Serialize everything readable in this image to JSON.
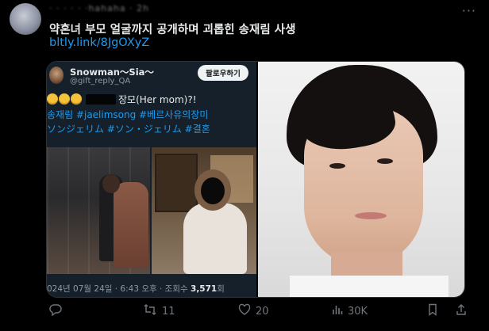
{
  "header": {
    "meta": "· · · · · ·hahaha · 2h"
  },
  "tweet": {
    "text": "약혼녀 부모 얼굴까지 공개하며 괴롭힌 송재림 사생",
    "link": "bltly.link/8JgOXyZ"
  },
  "embedded": {
    "name": "Snowman〜Sia〜",
    "handle": "@gift_reply_QA",
    "translate_button": "팔로우하기",
    "text_line1": "장모(Her mom)?!",
    "hashtags_line1": "송재림 #jaelimsong #베르사유의장미",
    "hashtags_line2": "ソンジェリム #ソン・ジェリム #결혼",
    "timestamp": "024년 07월 24일 · 6:43 오후 · 조회수",
    "views": "3,571",
    "views_suffix": "회"
  },
  "actions": {
    "reply_count": "",
    "retweet_count": "11",
    "like_count": "20",
    "view_count": "30K"
  }
}
